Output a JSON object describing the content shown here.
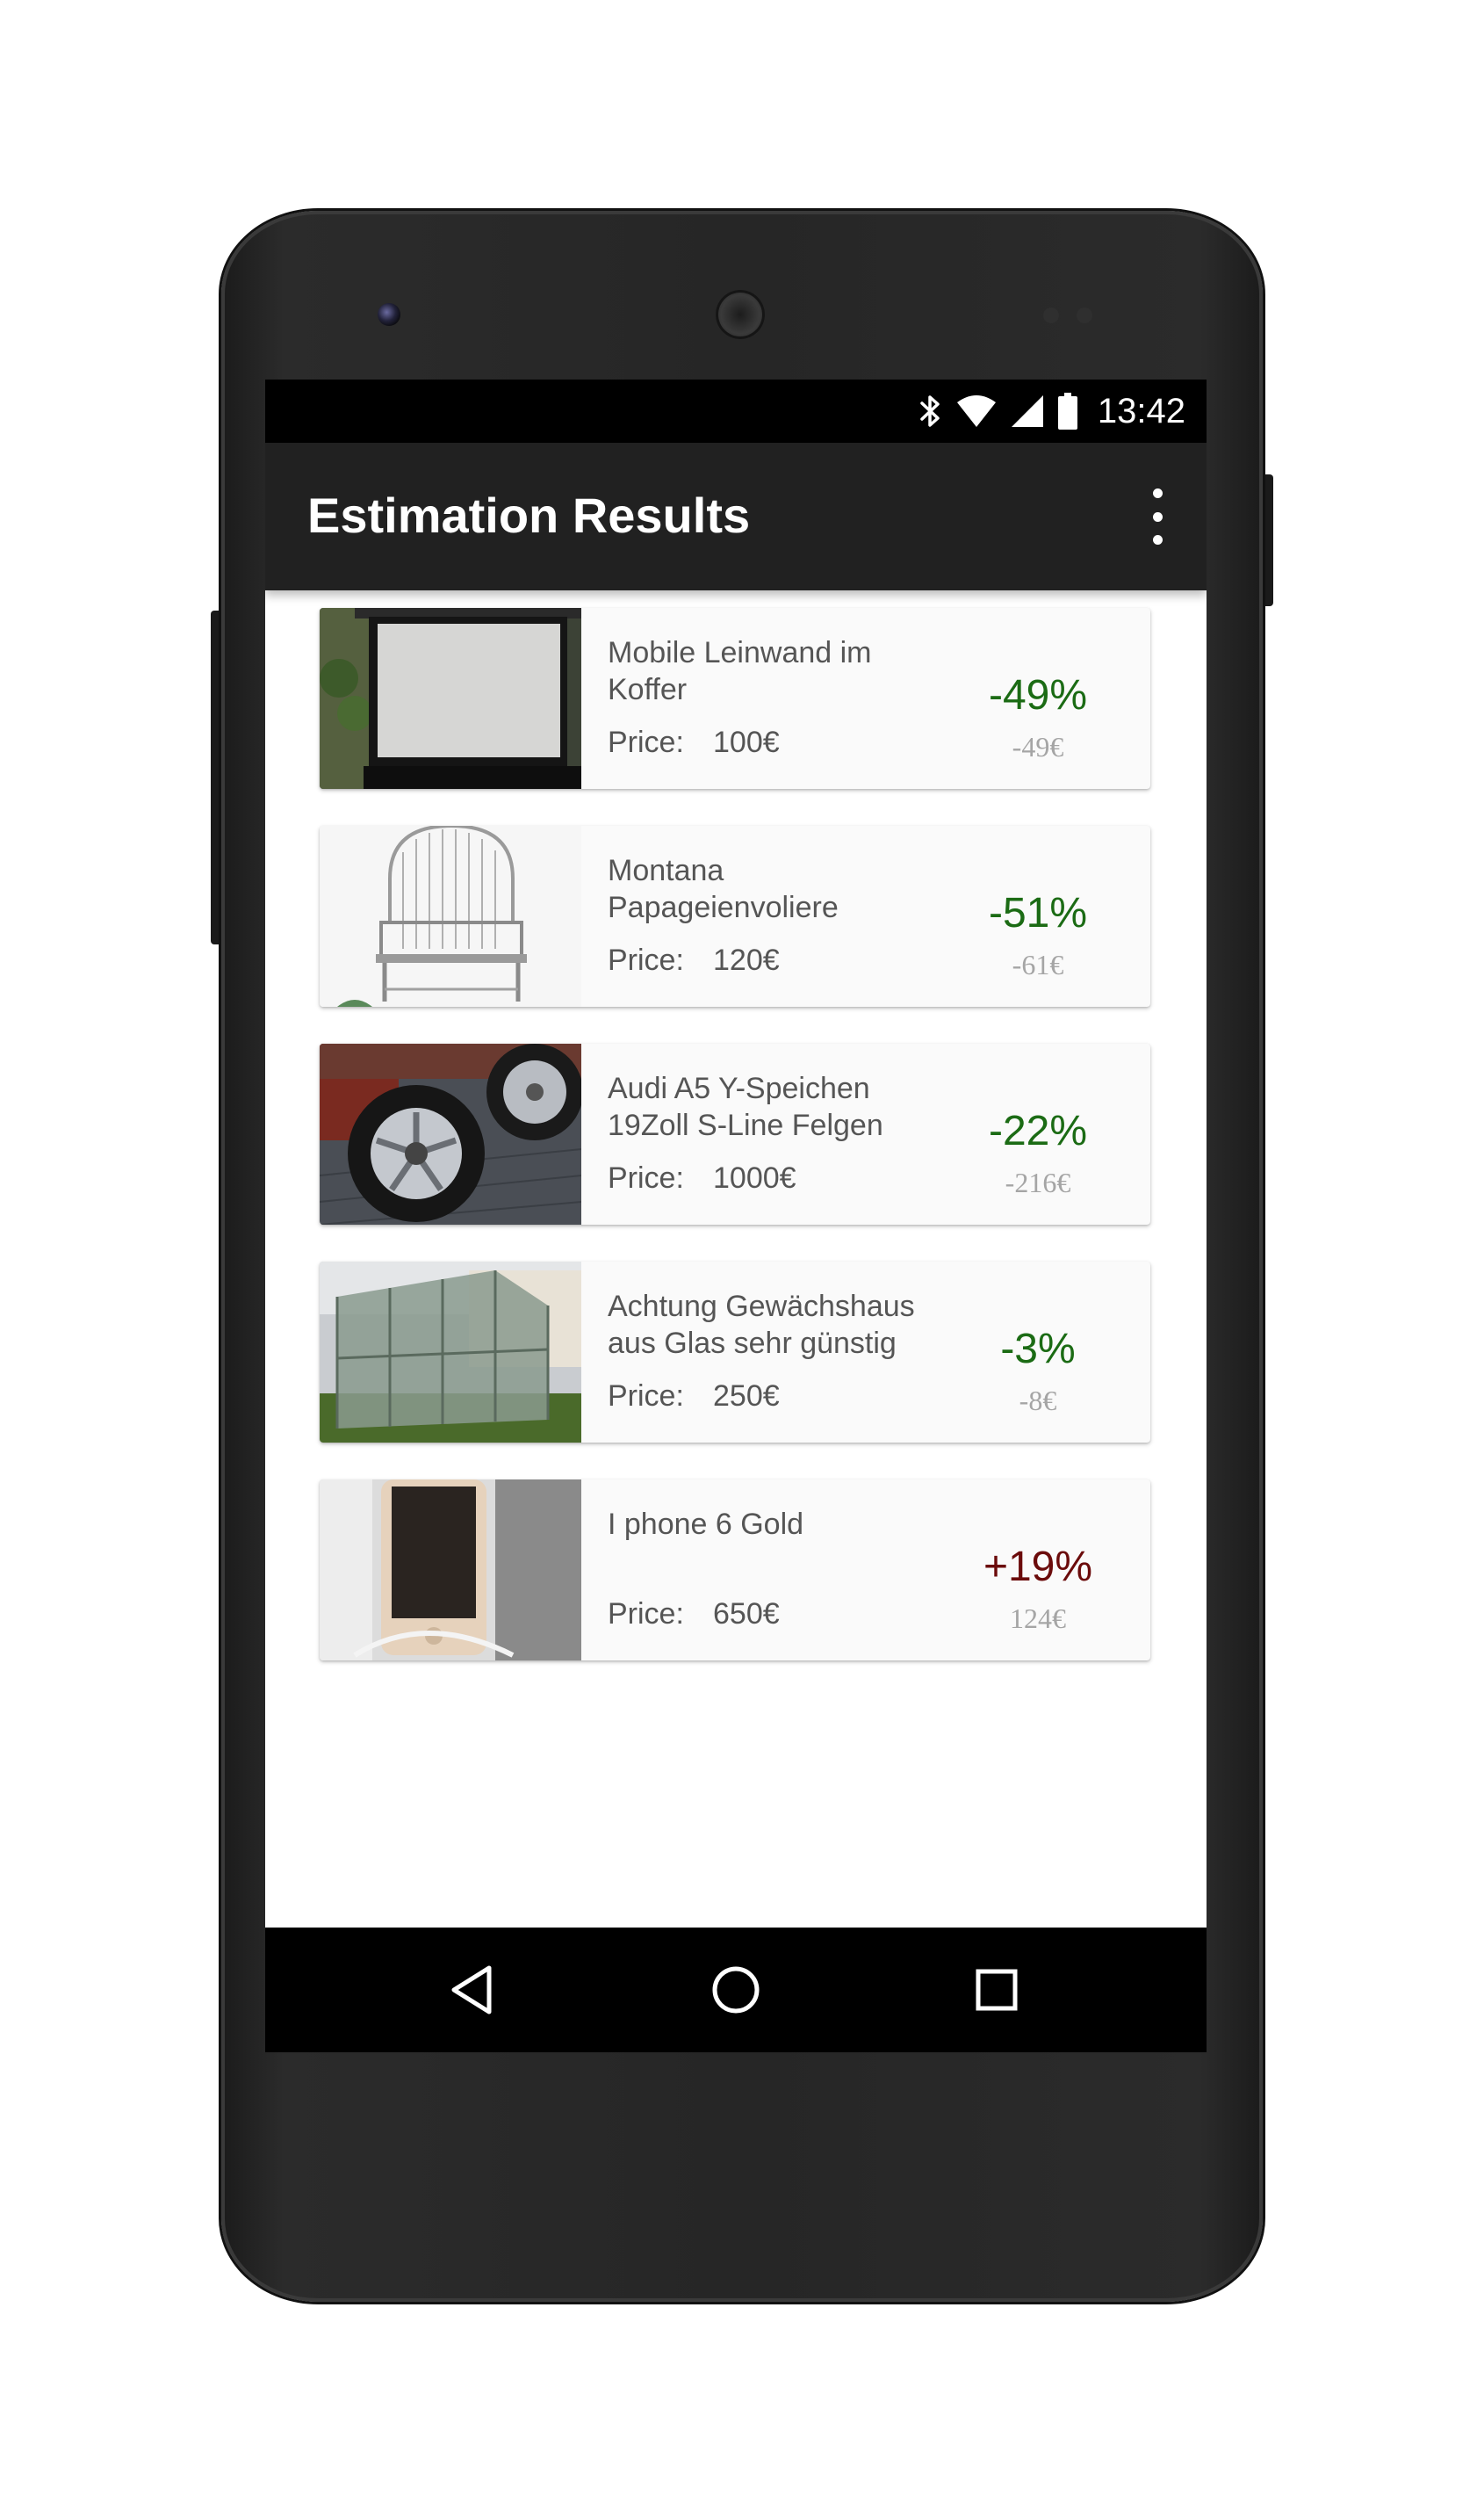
{
  "status_bar": {
    "time": "13:42",
    "icons": [
      "bluetooth-icon",
      "wifi-icon",
      "cell-signal-icon",
      "battery-icon"
    ]
  },
  "app_bar": {
    "title": "Estimation Results",
    "menu_icon": "overflow-menu-icon"
  },
  "items": [
    {
      "title": "Mobile Leinwand im Koffer",
      "price_label": "Price:",
      "price": "100€",
      "percent": "-49%",
      "difference": "-49€",
      "trend": "negative",
      "thumbnail": "projector-screen-photo"
    },
    {
      "title": "Montana Papageienvoliere",
      "price_label": "Price:",
      "price": "120€",
      "percent": "-51%",
      "difference": "-61€",
      "trend": "negative",
      "thumbnail": "bird-cage-photo"
    },
    {
      "title": "Audi A5 Y-Speichen 19Zoll S-Line Felgen",
      "price_label": "Price:",
      "price": "1000€",
      "percent": "-22%",
      "difference": "-216€",
      "trend": "negative",
      "thumbnail": "car-wheels-photo"
    },
    {
      "title": "Achtung Gewächshaus aus Glas sehr günstig",
      "price_label": "Price:",
      "price": "250€",
      "percent": "-3%",
      "difference": "-8€",
      "trend": "negative",
      "thumbnail": "greenhouse-photo"
    },
    {
      "title": "I phone 6 Gold",
      "price_label": "Price:",
      "price": "650€",
      "percent": "+19%",
      "difference": "124€",
      "trend": "positive",
      "thumbnail": "iphone-photo"
    }
  ],
  "nav_bar": {
    "buttons": [
      "back-icon",
      "home-icon",
      "recents-icon"
    ]
  },
  "colors": {
    "app_bar": "#212121",
    "negative_percent": "#1b6b14",
    "positive_percent": "#6b0b0b",
    "difference_text": "#a5a5a5"
  }
}
